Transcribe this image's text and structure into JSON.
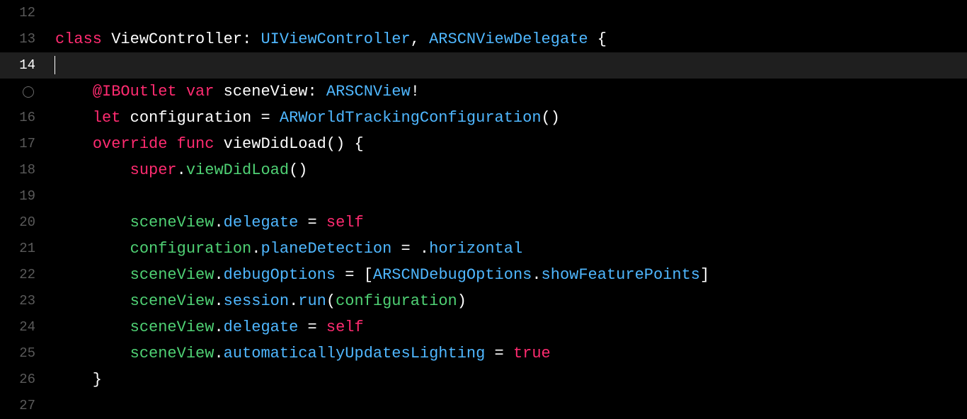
{
  "editor": {
    "lines": [
      {
        "num": "12",
        "current": false,
        "circle": false,
        "highlighted": false,
        "tokens": []
      },
      {
        "num": "13",
        "current": false,
        "circle": false,
        "highlighted": false,
        "tokens": [
          {
            "t": "class ",
            "c": "kw-pink"
          },
          {
            "t": "ViewController",
            "c": "kw-white"
          },
          {
            "t": ": ",
            "c": "kw-white"
          },
          {
            "t": "UIViewController",
            "c": "kw-blue"
          },
          {
            "t": ", ",
            "c": "kw-white"
          },
          {
            "t": "ARSCNViewDelegate",
            "c": "kw-blue"
          },
          {
            "t": " {",
            "c": "kw-white"
          }
        ]
      },
      {
        "num": "14",
        "current": true,
        "circle": false,
        "highlighted": true,
        "tokens": [],
        "cursor": true
      },
      {
        "num": "",
        "current": false,
        "circle": true,
        "highlighted": false,
        "tokens": [
          {
            "t": "    ",
            "c": "kw-white"
          },
          {
            "t": "@IBOutlet ",
            "c": "kw-pink"
          },
          {
            "t": "var ",
            "c": "kw-pink"
          },
          {
            "t": "sceneView",
            "c": "kw-white"
          },
          {
            "t": ": ",
            "c": "kw-white"
          },
          {
            "t": "ARSCNView",
            "c": "kw-blue"
          },
          {
            "t": "!",
            "c": "kw-white"
          }
        ]
      },
      {
        "num": "16",
        "current": false,
        "circle": false,
        "highlighted": false,
        "tokens": [
          {
            "t": "    ",
            "c": "kw-white"
          },
          {
            "t": "let ",
            "c": "kw-pink"
          },
          {
            "t": "configuration",
            "c": "kw-white"
          },
          {
            "t": " = ",
            "c": "kw-white"
          },
          {
            "t": "ARWorldTrackingConfiguration",
            "c": "kw-blue"
          },
          {
            "t": "()",
            "c": "kw-white"
          }
        ]
      },
      {
        "num": "17",
        "current": false,
        "circle": false,
        "highlighted": false,
        "tokens": [
          {
            "t": "    ",
            "c": "kw-white"
          },
          {
            "t": "override ",
            "c": "kw-pink"
          },
          {
            "t": "func ",
            "c": "kw-pink"
          },
          {
            "t": "viewDidLoad",
            "c": "kw-white"
          },
          {
            "t": "() {",
            "c": "kw-white"
          }
        ]
      },
      {
        "num": "18",
        "current": false,
        "circle": false,
        "highlighted": false,
        "tokens": [
          {
            "t": "        ",
            "c": "kw-white"
          },
          {
            "t": "super",
            "c": "kw-pink"
          },
          {
            "t": ".",
            "c": "kw-white"
          },
          {
            "t": "viewDidLoad",
            "c": "kw-green"
          },
          {
            "t": "()",
            "c": "kw-white"
          }
        ]
      },
      {
        "num": "19",
        "current": false,
        "circle": false,
        "highlighted": false,
        "tokens": []
      },
      {
        "num": "20",
        "current": false,
        "circle": false,
        "highlighted": false,
        "tokens": [
          {
            "t": "        ",
            "c": "kw-white"
          },
          {
            "t": "sceneView",
            "c": "kw-green"
          },
          {
            "t": ".",
            "c": "kw-white"
          },
          {
            "t": "delegate",
            "c": "kw-blue"
          },
          {
            "t": " = ",
            "c": "kw-white"
          },
          {
            "t": "self",
            "c": "kw-pink"
          }
        ]
      },
      {
        "num": "21",
        "current": false,
        "circle": false,
        "highlighted": false,
        "tokens": [
          {
            "t": "        ",
            "c": "kw-white"
          },
          {
            "t": "configuration",
            "c": "kw-green"
          },
          {
            "t": ".",
            "c": "kw-white"
          },
          {
            "t": "planeDetection",
            "c": "kw-blue"
          },
          {
            "t": " = .",
            "c": "kw-white"
          },
          {
            "t": "horizontal",
            "c": "kw-blue"
          }
        ]
      },
      {
        "num": "22",
        "current": false,
        "circle": false,
        "highlighted": false,
        "tokens": [
          {
            "t": "        ",
            "c": "kw-white"
          },
          {
            "t": "sceneView",
            "c": "kw-green"
          },
          {
            "t": ".",
            "c": "kw-white"
          },
          {
            "t": "debugOptions",
            "c": "kw-blue"
          },
          {
            "t": " = [",
            "c": "kw-white"
          },
          {
            "t": "ARSCNDebugOptions",
            "c": "kw-blue"
          },
          {
            "t": ".",
            "c": "kw-white"
          },
          {
            "t": "showFeaturePoints",
            "c": "kw-blue"
          },
          {
            "t": "]",
            "c": "kw-white"
          }
        ]
      },
      {
        "num": "23",
        "current": false,
        "circle": false,
        "highlighted": false,
        "tokens": [
          {
            "t": "        ",
            "c": "kw-white"
          },
          {
            "t": "sceneView",
            "c": "kw-green"
          },
          {
            "t": ".",
            "c": "kw-white"
          },
          {
            "t": "session",
            "c": "kw-blue"
          },
          {
            "t": ".",
            "c": "kw-white"
          },
          {
            "t": "run",
            "c": "kw-blue"
          },
          {
            "t": "(",
            "c": "kw-white"
          },
          {
            "t": "configuration",
            "c": "kw-green"
          },
          {
            "t": ")",
            "c": "kw-white"
          }
        ]
      },
      {
        "num": "24",
        "current": false,
        "circle": false,
        "highlighted": false,
        "tokens": [
          {
            "t": "        ",
            "c": "kw-white"
          },
          {
            "t": "sceneView",
            "c": "kw-green"
          },
          {
            "t": ".",
            "c": "kw-white"
          },
          {
            "t": "delegate",
            "c": "kw-blue"
          },
          {
            "t": " = ",
            "c": "kw-white"
          },
          {
            "t": "self",
            "c": "kw-pink"
          }
        ]
      },
      {
        "num": "25",
        "current": false,
        "circle": false,
        "highlighted": false,
        "tokens": [
          {
            "t": "        ",
            "c": "kw-white"
          },
          {
            "t": "sceneView",
            "c": "kw-green"
          },
          {
            "t": ".",
            "c": "kw-white"
          },
          {
            "t": "automaticallyUpdatesLighting",
            "c": "kw-blue"
          },
          {
            "t": " = ",
            "c": "kw-white"
          },
          {
            "t": "true",
            "c": "kw-pink"
          }
        ]
      },
      {
        "num": "26",
        "current": false,
        "circle": false,
        "highlighted": false,
        "tokens": [
          {
            "t": "    }",
            "c": "kw-white"
          }
        ]
      },
      {
        "num": "27",
        "current": false,
        "circle": false,
        "highlighted": false,
        "tokens": []
      }
    ]
  }
}
